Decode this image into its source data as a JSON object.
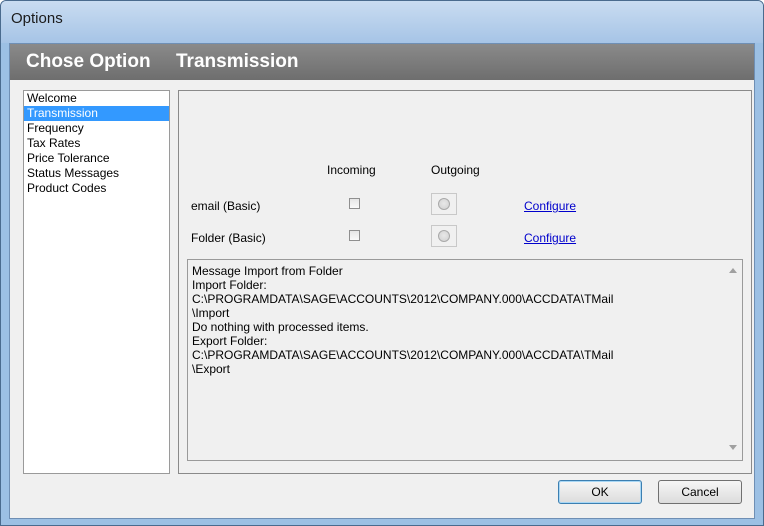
{
  "window": {
    "title": "Options"
  },
  "header": {
    "label": "Chose Option",
    "value": "Transmission"
  },
  "nav": {
    "items": [
      {
        "label": "Welcome",
        "selected": false
      },
      {
        "label": "Transmission",
        "selected": true
      },
      {
        "label": "Frequency",
        "selected": false
      },
      {
        "label": "Tax Rates",
        "selected": false
      },
      {
        "label": "Price Tolerance",
        "selected": false
      },
      {
        "label": "Status Messages",
        "selected": false
      },
      {
        "label": "Product Codes",
        "selected": false
      }
    ]
  },
  "transmission": {
    "columns": {
      "incoming": "Incoming",
      "outgoing": "Outgoing"
    },
    "rows": [
      {
        "label": "email (Basic)",
        "incoming_checked": false,
        "outgoing_selected": false,
        "link": "Configure"
      },
      {
        "label": "Folder (Basic)",
        "incoming_checked": false,
        "outgoing_selected": false,
        "link": "Configure"
      }
    ]
  },
  "message": {
    "text": "Message Import from Folder\nImport Folder:\nC:\\PROGRAMDATA\\SAGE\\ACCOUNTS\\2012\\COMPANY.000\\ACCDATA\\TMail\n\\Import\nDo nothing with processed items.\nExport Folder:\nC:\\PROGRAMDATA\\SAGE\\ACCOUNTS\\2012\\COMPANY.000\\ACCDATA\\TMail\n\\Export"
  },
  "buttons": {
    "ok": "OK",
    "cancel": "Cancel"
  }
}
